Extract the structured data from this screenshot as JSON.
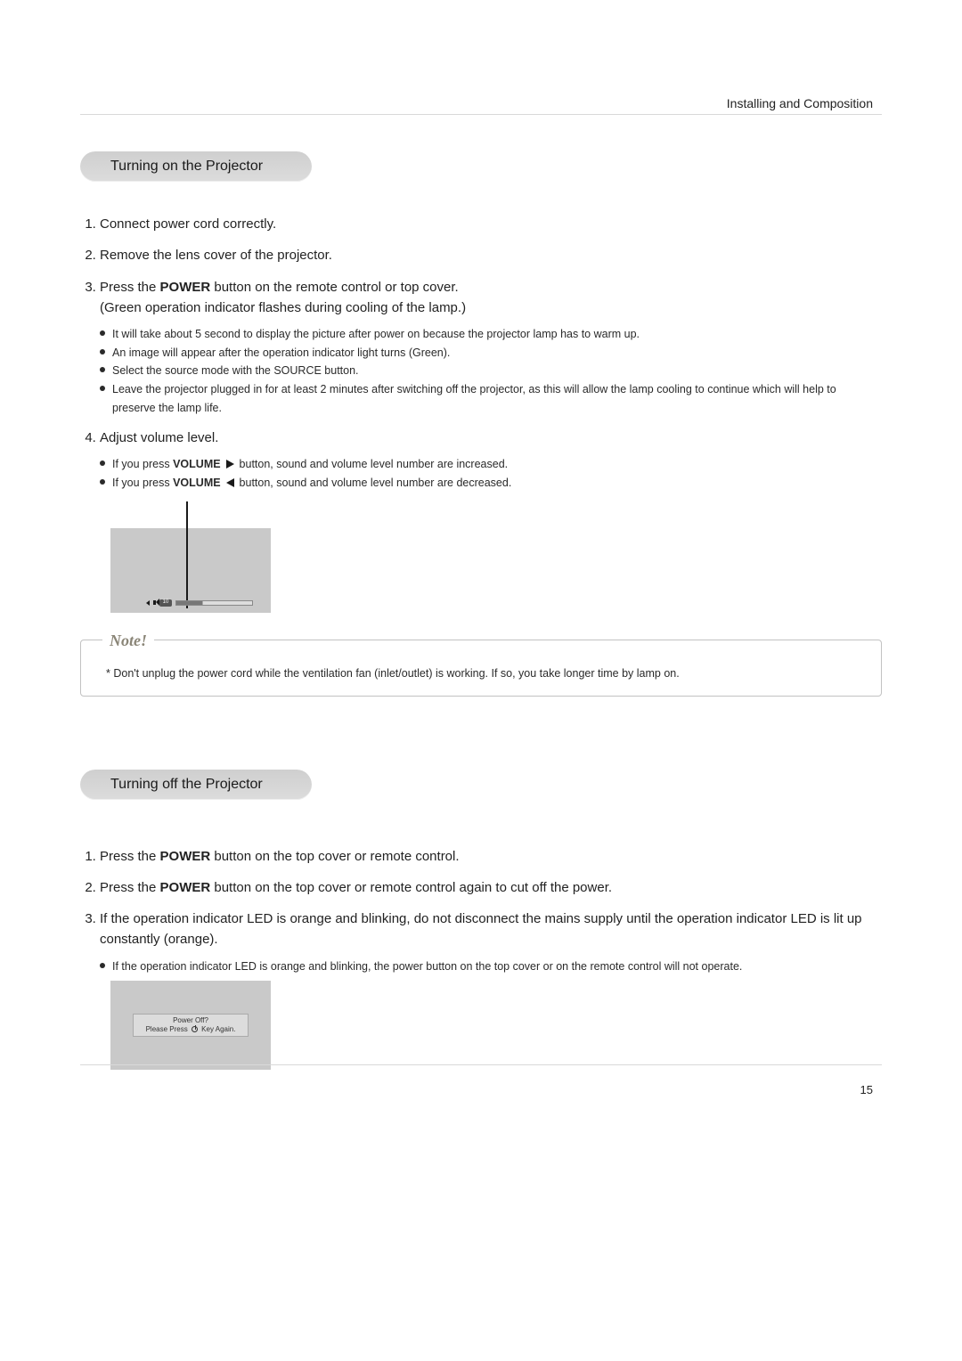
{
  "header": {
    "right": "Installing and Composition"
  },
  "page_number": "15",
  "section_on": {
    "title": "Turning on the Projector",
    "items": [
      {
        "text": "Connect power cord correctly."
      },
      {
        "text": "Remove the lens cover of the projector."
      },
      {
        "prefix": "Press the ",
        "bold": "POWER",
        "suffix": " button on the remote control or top cover.",
        "after": "(Green operation indicator flashes during cooling of the lamp.)",
        "bullets": [
          "It will take about 5 second to display the picture after power on because the projector lamp has to warm up.",
          "An image will appear after the operation indicator light turns (Green).",
          "Select the source mode with the SOURCE button.",
          "Leave the projector plugged in for at least 2 minutes after switching off the projector, as this will allow the lamp cooling to continue which will help to preserve the lamp life."
        ]
      },
      {
        "text": "Adjust volume level.",
        "vol_bullets": {
          "inc_pre": "If you press ",
          "inc_b": "VOLUME",
          "inc_post": " button, sound and volume level number are increased.",
          "dec_pre": "If you press ",
          "dec_b": "VOLUME",
          "dec_post": " button, sound and volume level number are decreased."
        }
      }
    ]
  },
  "diagram1": {
    "volume_value": "10"
  },
  "note": {
    "label": "Note!",
    "text": "* Don't unplug the power cord while the ventilation fan (inlet/outlet) is working. If so, you take longer time by lamp on."
  },
  "section_off": {
    "title": "Turning off the Projector",
    "items": [
      {
        "prefix": "Press the ",
        "bold": "POWER",
        "suffix": " button on the top cover or remote control."
      },
      {
        "prefix": "Press the ",
        "bold": "POWER",
        "suffix": " button on the top cover or remote control again to cut off the power."
      },
      {
        "text": "If the operation indicator LED is orange and blinking, do not disconnect the mains supply until the operation indicator LED is lit up constantly (orange).",
        "bullets": [
          "If the operation indicator LED is  orange and blinking, the power button on the top cover or on the remote control will not operate."
        ]
      }
    ]
  },
  "diagram2": {
    "line1": "Power Off?",
    "line2_pre": "Please Press ",
    "line2_post": " Key Again."
  }
}
